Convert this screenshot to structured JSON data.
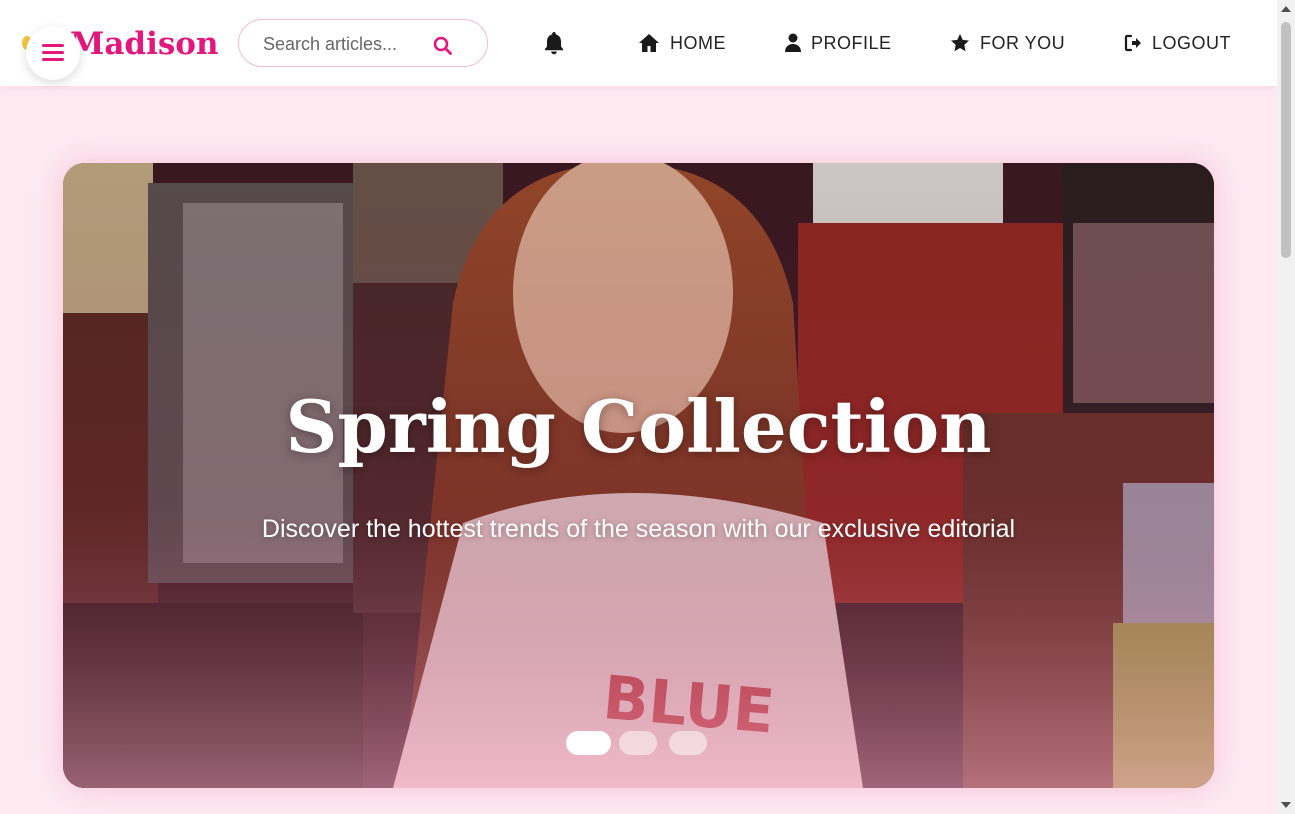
{
  "brand": {
    "name": "Madison",
    "accent_color": "#e3177e",
    "dot_color": "#f4c542"
  },
  "menu": {
    "icon": "hamburger-menu-icon"
  },
  "search": {
    "placeholder": "Search articles...",
    "value": "",
    "icon": "search-icon"
  },
  "notifications": {
    "icon": "bell-icon"
  },
  "nav": {
    "items": [
      {
        "label": "HOME",
        "icon": "home-icon"
      },
      {
        "label": "PROFILE",
        "icon": "user-icon"
      },
      {
        "label": "FOR YOU",
        "icon": "star-icon"
      },
      {
        "label": "LOGOUT",
        "icon": "logout-icon"
      }
    ]
  },
  "hero": {
    "title": "Spring Collection",
    "subtitle": "Discover the hottest trends of the season with our exclusive editorial",
    "image": "editorial-photo-collage",
    "slides_total": 3,
    "active_slide": 1
  }
}
